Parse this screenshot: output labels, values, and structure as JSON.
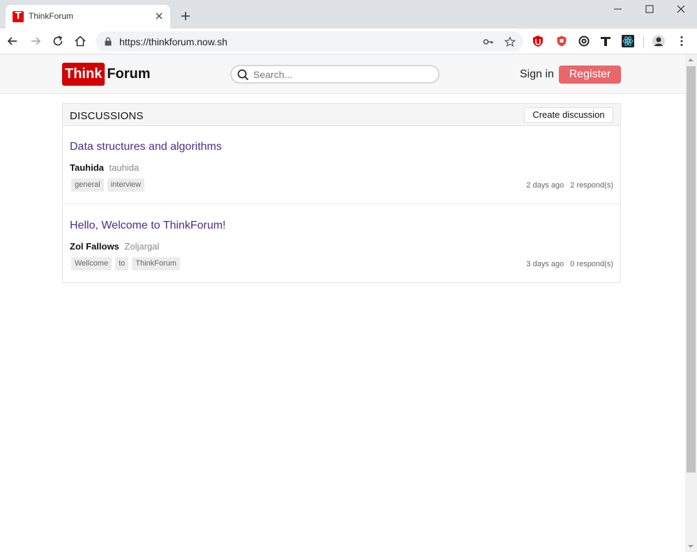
{
  "browser": {
    "tab_title": "ThinkForum",
    "favicon_letter": "T",
    "url": "https://thinkforum.now.sh"
  },
  "header": {
    "logo_think": "Think",
    "logo_forum": "Forum",
    "search_placeholder": "Search...",
    "signin_label": "Sign in",
    "register_label": "Register"
  },
  "discussions": {
    "title": "DISCUSSIONS",
    "create_label": "Create discussion",
    "items": [
      {
        "title": "Data structures and algorithms",
        "author_name": "Tauhida",
        "author_username": "tauhida",
        "tags": [
          "general",
          "interview"
        ],
        "time": "2 days ago",
        "responses": "2 respond(s)"
      },
      {
        "title": "Hello, Welcome to ThinkForum!",
        "author_name": "Zol Fallows",
        "author_username": "Zoljargal",
        "tags": [
          "Wellcome",
          "to",
          "ThinkForum"
        ],
        "time": "3 days ago",
        "responses": "0 respond(s)"
      }
    ]
  },
  "colors": {
    "brand_red": "#d40000",
    "register_bg": "#e9666b",
    "link_purple": "#4f2b8e"
  }
}
